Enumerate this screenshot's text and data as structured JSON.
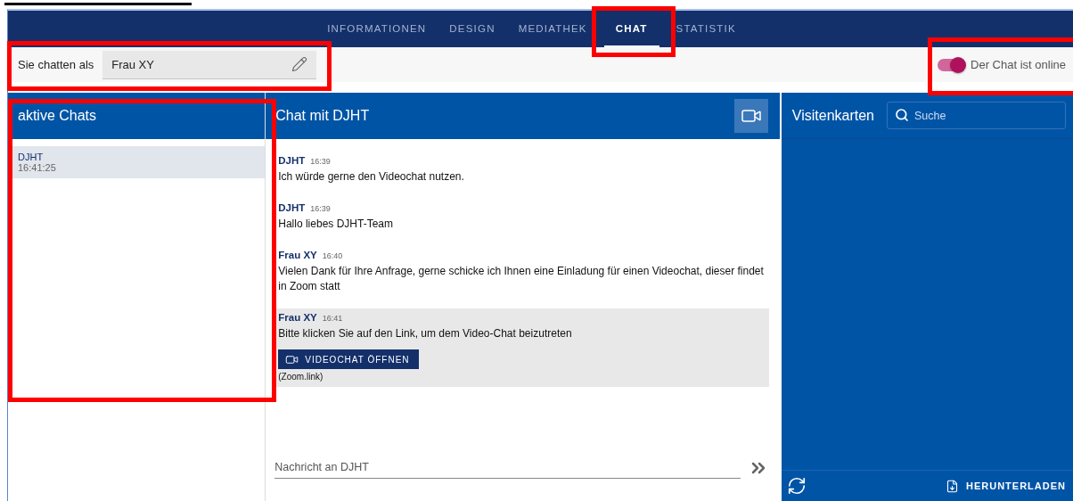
{
  "tabs": [
    {
      "label": "INFORMATIONEN",
      "selected": false
    },
    {
      "label": "DESIGN",
      "selected": false
    },
    {
      "label": "MEDIATHEK",
      "selected": false
    },
    {
      "label": "CHAT",
      "selected": true
    },
    {
      "label": "STATISTIK",
      "selected": false
    }
  ],
  "identity": {
    "label": "Sie chatten als",
    "value": "Frau XY"
  },
  "online_toggle": {
    "label": "Der Chat ist online",
    "on": true
  },
  "active_chats": {
    "title": "aktive Chats",
    "items": [
      {
        "name": "DJHT",
        "time": "16:41:25",
        "selected": true
      }
    ]
  },
  "chat": {
    "title": "Chat mit DJHT",
    "messages": [
      {
        "author": "DJHT",
        "time": "16:39",
        "text": "Ich würde gerne den Videochat nutzen.",
        "highlighted": false
      },
      {
        "author": "DJHT",
        "time": "16:39",
        "text": "Hallo liebes DJHT-Team",
        "highlighted": false
      },
      {
        "author": "Frau XY",
        "time": "16:40",
        "text": "Vielen Dank für Ihre Anfrage, gerne schicke ich Ihnen eine Einladung für einen Videochat, dieser findet in Zoom statt",
        "highlighted": false
      },
      {
        "author": "Frau XY",
        "time": "16:41",
        "text": "Bitte klicken Sie auf den Link, um dem Video-Chat beizutreten",
        "highlighted": true,
        "button": "VIDEOCHAT ÖFFNEN",
        "note": "(Zoom.link)"
      }
    ],
    "input": {
      "placeholder": "Nachricht an DJHT"
    }
  },
  "cards": {
    "title": "Visitenkarten",
    "search": {
      "placeholder": "Suche"
    },
    "download": "HERUNTERLADEN"
  }
}
